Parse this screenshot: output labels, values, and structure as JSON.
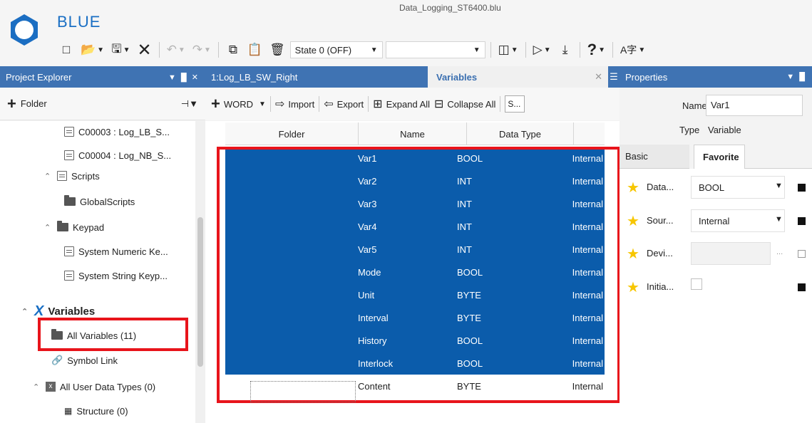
{
  "app": {
    "name": "BLUE",
    "document_title": "Data_Logging_ST6400.blu"
  },
  "toolbar": {
    "state_value": "State 0 (OFF)",
    "second_combo_value": ""
  },
  "project_explorer": {
    "title": "Project Explorer",
    "folder_button": "Folder",
    "tree": [
      {
        "label": "C00003 : Log_LB_S...",
        "icon": "document-icon"
      },
      {
        "label": "C00004 : Log_NB_S...",
        "icon": "document-icon"
      },
      {
        "label": "Scripts",
        "icon": "scripts-icon"
      },
      {
        "label": "GlobalScripts",
        "icon": "folder-icon"
      },
      {
        "label": "Keypad",
        "icon": "folder-icon"
      },
      {
        "label": "System Numeric Ke...",
        "icon": "document-icon"
      },
      {
        "label": "System String Keyp...",
        "icon": "document-icon"
      },
      {
        "label": "Variables",
        "icon": "variables-icon"
      },
      {
        "label": "All Variables (11)",
        "icon": "folder-icon"
      },
      {
        "label": "Symbol Link",
        "icon": "link-icon"
      },
      {
        "label": "All User Data Types (0)",
        "icon": "user-data-type-icon"
      },
      {
        "label": "Structure (0)",
        "icon": "structure-icon"
      }
    ]
  },
  "tabs": {
    "log_tab": "1:Log_LB_SW_Right",
    "variables_tab": "Variables"
  },
  "center_toolbar": {
    "word_button": "WORD",
    "import": "Import",
    "export": "Export",
    "expand_all": "Expand All",
    "collapse_all": "Collapse All",
    "search_value": "S..."
  },
  "grid": {
    "headers": [
      "Folder",
      "Name",
      "Data Type"
    ],
    "rows": [
      {
        "name": "Var1",
        "type": "BOOL",
        "source": "Internal",
        "selected": true
      },
      {
        "name": "Var2",
        "type": "INT",
        "source": "Internal",
        "selected": true
      },
      {
        "name": "Var3",
        "type": "INT",
        "source": "Internal",
        "selected": true
      },
      {
        "name": "Var4",
        "type": "INT",
        "source": "Internal",
        "selected": true
      },
      {
        "name": "Var5",
        "type": "INT",
        "source": "Internal",
        "selected": true
      },
      {
        "name": "Mode",
        "type": "BOOL",
        "source": "Internal",
        "selected": true
      },
      {
        "name": "Unit",
        "type": "BYTE",
        "source": "Internal",
        "selected": true
      },
      {
        "name": "Interval",
        "type": "BYTE",
        "source": "Internal",
        "selected": true
      },
      {
        "name": "History",
        "type": "BOOL",
        "source": "Internal",
        "selected": true
      },
      {
        "name": "Interlock",
        "type": "BOOL",
        "source": "Internal",
        "selected": true
      },
      {
        "name": "Content",
        "type": "BYTE",
        "source": "Internal",
        "selected": false
      }
    ]
  },
  "properties": {
    "title": "Properties",
    "name_label": "Name",
    "name_value": "Var1",
    "type_label": "Type",
    "type_value": "Variable",
    "tab_basic": "Basic",
    "tab_favorite": "Favorite",
    "fields": [
      {
        "label": "Data...",
        "value": "BOOL"
      },
      {
        "label": "Sour...",
        "value": "Internal"
      },
      {
        "label": "Devi...",
        "value": ""
      },
      {
        "label": "Initia...",
        "value": ""
      }
    ]
  },
  "colors": {
    "accent": "#3f73b3",
    "selection": "#0b5cab",
    "highlight_box": "#e8141b",
    "star": "#f7c600"
  }
}
